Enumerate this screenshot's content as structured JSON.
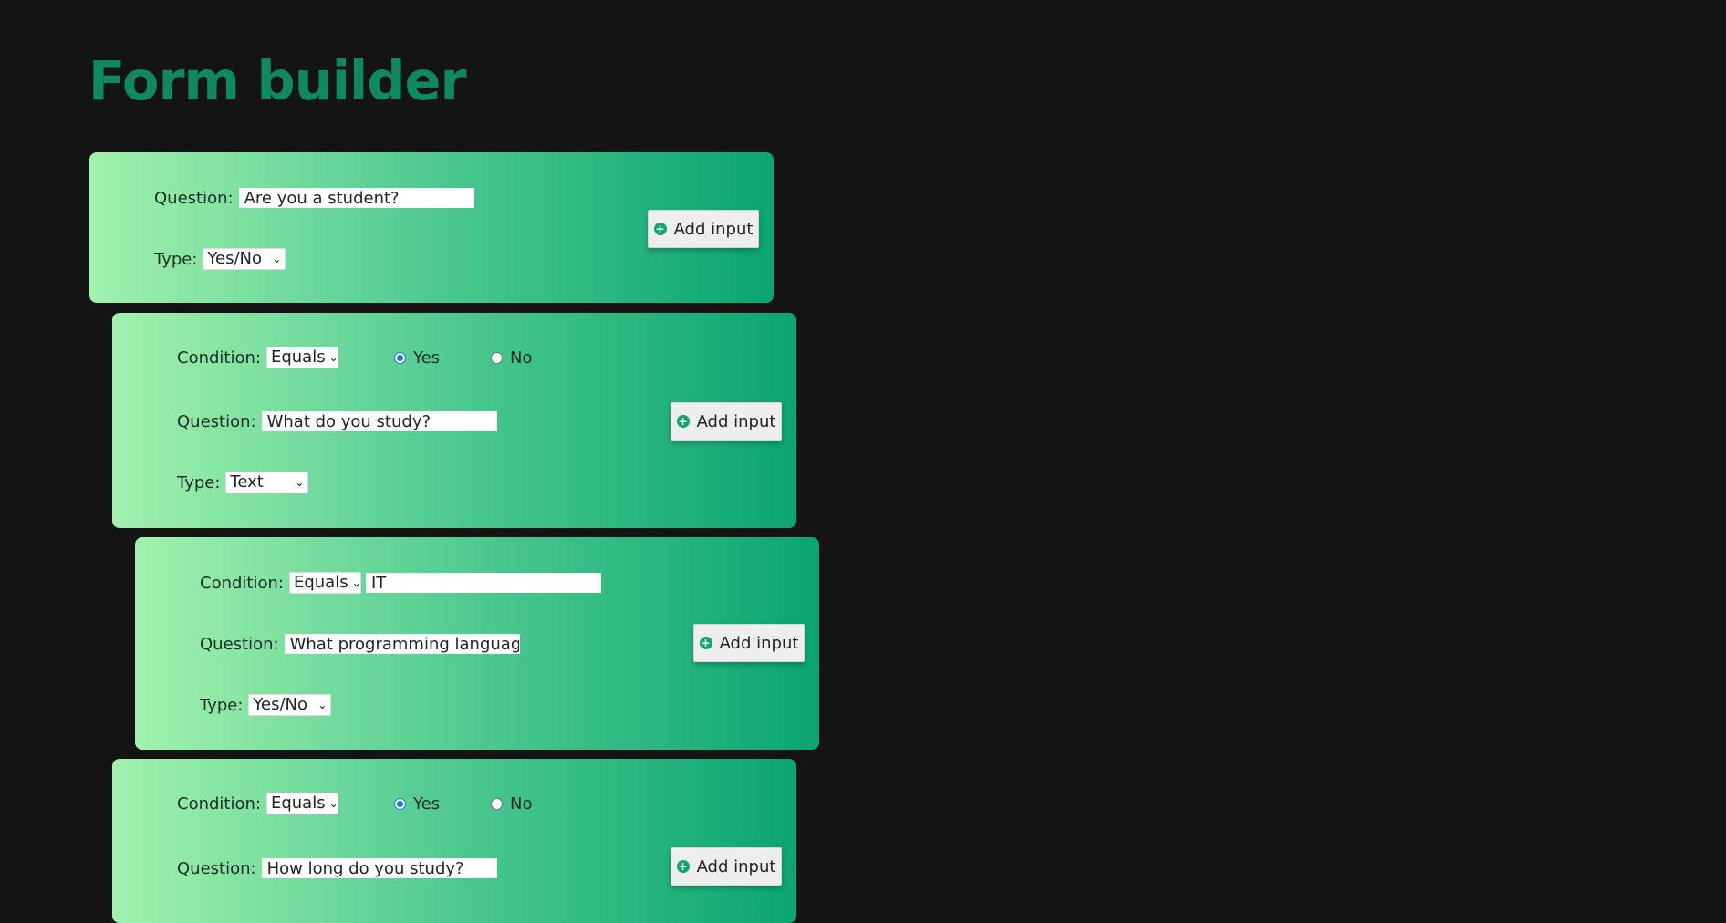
{
  "page": {
    "title": "Form builder"
  },
  "labels": {
    "question": "Question:",
    "type": "Type:",
    "condition": "Condition:",
    "add_input": "Add input"
  },
  "cards": [
    {
      "question": "Are you a student?",
      "type": "Yes/No"
    },
    {
      "condition": "Equals",
      "radio_yes": "Yes",
      "radio_no": "No",
      "selected": "Yes",
      "question": "What do you study?",
      "type": "Text"
    },
    {
      "condition": "Equals",
      "condition_value": "IT",
      "question": "What programming language?",
      "type": "Yes/No"
    },
    {
      "condition": "Equals",
      "radio_yes": "Yes",
      "radio_no": "No",
      "selected": "Yes",
      "question": "How long do you study?"
    }
  ],
  "icons": {
    "add": "plus-circle-icon",
    "dropdown": "chevron-down-icon"
  },
  "colors": {
    "background": "#141414",
    "title": "#0f8a5f",
    "accent": "#10a673",
    "radio_selected": "#1a73e8"
  }
}
